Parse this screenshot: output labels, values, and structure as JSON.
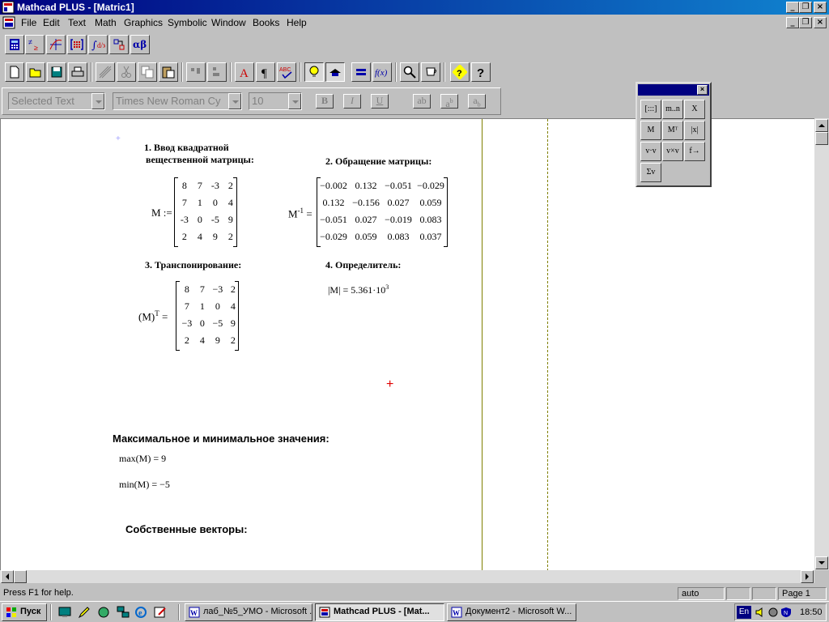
{
  "window": {
    "title": "Mathcad PLUS - [Matric1]"
  },
  "menu": [
    "File",
    "Edit",
    "Text",
    "Math",
    "Graphics",
    "Symbolic",
    "Window",
    "Books",
    "Help"
  ],
  "format_bar": {
    "style": "Selected Text",
    "font": "Times New Roman Cy",
    "size": "10",
    "bold": "B",
    "italic": "I",
    "underline": "U"
  },
  "toolbar": {
    "math_palette_icons": [
      "calculator-icon",
      "relational-icon",
      "graph-icon",
      "matrix-icon",
      "calculus-icon",
      "programming-icon",
      "greek-icon"
    ],
    "standard_icons": [
      "new-icon",
      "open-icon",
      "save-icon",
      "print-icon",
      "check-icon",
      "cut-icon",
      "copy-icon",
      "paste-icon",
      "align-across-icon",
      "align-down-icon",
      "text-icon",
      "paragraph-icon",
      "spellcheck-icon",
      "calculate-icon",
      "lightbulb-icon",
      "equals-icon",
      "function-icon",
      "zoom-icon",
      "resources-icon",
      "help-icon"
    ]
  },
  "doc": {
    "s1_title_1": "1. Ввод квадратной",
    "s1_title_2": "вещественной матрицы:",
    "s2_title": "2. Обращение матрицы:",
    "s3_title": "3. Транспонирование:",
    "s4_title": "4. Определитель:",
    "m_label": "M :=",
    "minv_label": "M",
    "minv_sup": "-1",
    "minv_eq": "=",
    "mt_label": "(M)",
    "mt_sup": "T",
    "mt_eq": "=",
    "matrix_M": [
      [
        "8",
        "7",
        "-3",
        "2"
      ],
      [
        "7",
        "1",
        "0",
        "4"
      ],
      [
        "-3",
        "0",
        "-5",
        "9"
      ],
      [
        "2",
        "4",
        "9",
        "2"
      ]
    ],
    "matrix_Minv": [
      [
        "−0.002",
        "0.132",
        "−0.051",
        "−0.029"
      ],
      [
        "0.132",
        "−0.156",
        "0.027",
        "0.059"
      ],
      [
        "−0.051",
        "0.027",
        "−0.019",
        "0.083"
      ],
      [
        "−0.029",
        "0.059",
        "0.083",
        "0.037"
      ]
    ],
    "matrix_MT": [
      [
        "8",
        "7",
        "−3",
        "2"
      ],
      [
        "7",
        "1",
        "0",
        "4"
      ],
      [
        "−3",
        "0",
        "−5",
        "9"
      ],
      [
        "2",
        "4",
        "9",
        "2"
      ]
    ],
    "det_expr": "|M| = 5.361·10",
    "det_exp": "3",
    "minmax_title": "Максимальное и минимальное значения:",
    "max_expr": "max(M) = 9",
    "min_expr": "min(M) = −5",
    "eig_title": "Собственные векторы:"
  },
  "palette": {
    "buttons": [
      "[:::]",
      "m..n",
      "X",
      "M",
      "Mᵀ",
      "|x|",
      "v·v",
      "v×v",
      "f→",
      "Σv"
    ]
  },
  "status": {
    "help": "Press F1 for help.",
    "mode": "auto",
    "page": "Page 1"
  },
  "taskbar": {
    "start": "Пуск",
    "tasks": [
      "лаб_№5_УМО - Microsoft ...",
      "Mathcad PLUS - [Mat...",
      "Документ2 - Microsoft W..."
    ],
    "lang": "En",
    "clock": "18:50"
  }
}
